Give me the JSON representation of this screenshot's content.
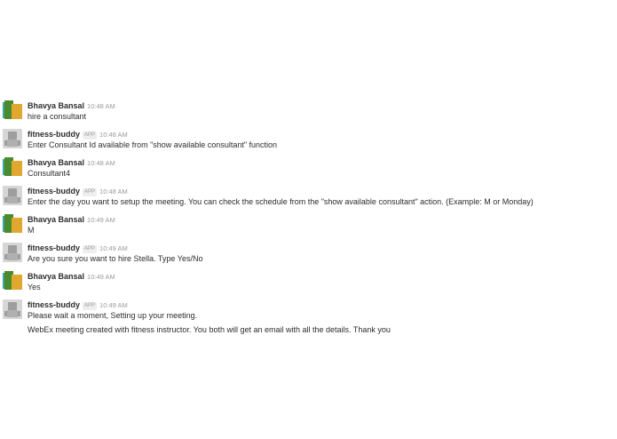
{
  "colors": {
    "user_avatar_green": "#4c8a2e",
    "user_avatar_yellow": "#e0a82e",
    "user_avatar_teal": "#3aa3a3",
    "bot_avatar_gray": "#b8b8b8",
    "name": "#2c2d30",
    "timestamp": "#9a9a9a"
  },
  "messages": [
    {
      "author": "Bhavya Bansal",
      "time": "10:48 AM",
      "text": "hire a consultant",
      "avatar": "user-avatar"
    },
    {
      "author": "fitness-buddy",
      "badge": "APP",
      "time": "10:48 AM",
      "text": "Enter Consultant Id available from \"show available consultant\" function",
      "avatar": "bot-avatar"
    },
    {
      "author": "Bhavya Bansal",
      "time": "10:48 AM",
      "text": "Consultant4",
      "avatar": "user-avatar"
    },
    {
      "author": "fitness-buddy",
      "badge": "APP",
      "time": "10:48 AM",
      "text": "Enter the day you want to setup the meeting. You can check the schedule from the \"show available consultant\" action. (Example: M or Monday)",
      "avatar": "bot-avatar"
    },
    {
      "author": "Bhavya Bansal",
      "time": "10:49 AM",
      "text": "M",
      "avatar": "user-avatar"
    },
    {
      "author": "fitness-buddy",
      "badge": "APP",
      "time": "10:49 AM",
      "text": "Are you sure you want to hire Stella. Type Yes/No",
      "avatar": "bot-avatar"
    },
    {
      "author": "Bhavya Bansal",
      "time": "10:49 AM",
      "text": "Yes",
      "avatar": "user-avatar"
    },
    {
      "author": "fitness-buddy",
      "badge": "APP",
      "time": "10:49 AM",
      "text": "Please wait a moment, Setting up your meeting.",
      "text2": "WebEx meeting created with fitness instructor. You both will get an email with all the details. Thank you",
      "avatar": "bot-avatar"
    }
  ]
}
